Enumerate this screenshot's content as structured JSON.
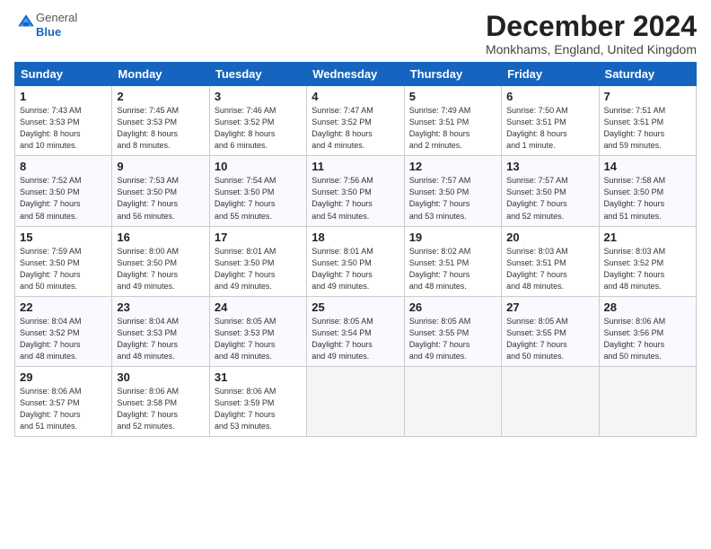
{
  "header": {
    "logo_general": "General",
    "logo_blue": "Blue",
    "month_title": "December 2024",
    "subtitle": "Monkhams, England, United Kingdom"
  },
  "days_of_week": [
    "Sunday",
    "Monday",
    "Tuesday",
    "Wednesday",
    "Thursday",
    "Friday",
    "Saturday"
  ],
  "weeks": [
    [
      {
        "day": "1",
        "sunrise": "7:43 AM",
        "sunset": "3:53 PM",
        "daylight": "8 hours and 10 minutes."
      },
      {
        "day": "2",
        "sunrise": "7:45 AM",
        "sunset": "3:53 PM",
        "daylight": "8 hours and 8 minutes."
      },
      {
        "day": "3",
        "sunrise": "7:46 AM",
        "sunset": "3:52 PM",
        "daylight": "8 hours and 6 minutes."
      },
      {
        "day": "4",
        "sunrise": "7:47 AM",
        "sunset": "3:52 PM",
        "daylight": "8 hours and 4 minutes."
      },
      {
        "day": "5",
        "sunrise": "7:49 AM",
        "sunset": "3:51 PM",
        "daylight": "8 hours and 2 minutes."
      },
      {
        "day": "6",
        "sunrise": "7:50 AM",
        "sunset": "3:51 PM",
        "daylight": "8 hours and 1 minute."
      },
      {
        "day": "7",
        "sunrise": "7:51 AM",
        "sunset": "3:51 PM",
        "daylight": "7 hours and 59 minutes."
      }
    ],
    [
      {
        "day": "8",
        "sunrise": "7:52 AM",
        "sunset": "3:50 PM",
        "daylight": "7 hours and 58 minutes."
      },
      {
        "day": "9",
        "sunrise": "7:53 AM",
        "sunset": "3:50 PM",
        "daylight": "7 hours and 56 minutes."
      },
      {
        "day": "10",
        "sunrise": "7:54 AM",
        "sunset": "3:50 PM",
        "daylight": "7 hours and 55 minutes."
      },
      {
        "day": "11",
        "sunrise": "7:56 AM",
        "sunset": "3:50 PM",
        "daylight": "7 hours and 54 minutes."
      },
      {
        "day": "12",
        "sunrise": "7:57 AM",
        "sunset": "3:50 PM",
        "daylight": "7 hours and 53 minutes."
      },
      {
        "day": "13",
        "sunrise": "7:57 AM",
        "sunset": "3:50 PM",
        "daylight": "7 hours and 52 minutes."
      },
      {
        "day": "14",
        "sunrise": "7:58 AM",
        "sunset": "3:50 PM",
        "daylight": "7 hours and 51 minutes."
      }
    ],
    [
      {
        "day": "15",
        "sunrise": "7:59 AM",
        "sunset": "3:50 PM",
        "daylight": "7 hours and 50 minutes."
      },
      {
        "day": "16",
        "sunrise": "8:00 AM",
        "sunset": "3:50 PM",
        "daylight": "7 hours and 49 minutes."
      },
      {
        "day": "17",
        "sunrise": "8:01 AM",
        "sunset": "3:50 PM",
        "daylight": "7 hours and 49 minutes."
      },
      {
        "day": "18",
        "sunrise": "8:01 AM",
        "sunset": "3:50 PM",
        "daylight": "7 hours and 49 minutes."
      },
      {
        "day": "19",
        "sunrise": "8:02 AM",
        "sunset": "3:51 PM",
        "daylight": "7 hours and 48 minutes."
      },
      {
        "day": "20",
        "sunrise": "8:03 AM",
        "sunset": "3:51 PM",
        "daylight": "7 hours and 48 minutes."
      },
      {
        "day": "21",
        "sunrise": "8:03 AM",
        "sunset": "3:52 PM",
        "daylight": "7 hours and 48 minutes."
      }
    ],
    [
      {
        "day": "22",
        "sunrise": "8:04 AM",
        "sunset": "3:52 PM",
        "daylight": "7 hours and 48 minutes."
      },
      {
        "day": "23",
        "sunrise": "8:04 AM",
        "sunset": "3:53 PM",
        "daylight": "7 hours and 48 minutes."
      },
      {
        "day": "24",
        "sunrise": "8:05 AM",
        "sunset": "3:53 PM",
        "daylight": "7 hours and 48 minutes."
      },
      {
        "day": "25",
        "sunrise": "8:05 AM",
        "sunset": "3:54 PM",
        "daylight": "7 hours and 49 minutes."
      },
      {
        "day": "26",
        "sunrise": "8:05 AM",
        "sunset": "3:55 PM",
        "daylight": "7 hours and 49 minutes."
      },
      {
        "day": "27",
        "sunrise": "8:05 AM",
        "sunset": "3:55 PM",
        "daylight": "7 hours and 50 minutes."
      },
      {
        "day": "28",
        "sunrise": "8:06 AM",
        "sunset": "3:56 PM",
        "daylight": "7 hours and 50 minutes."
      }
    ],
    [
      {
        "day": "29",
        "sunrise": "8:06 AM",
        "sunset": "3:57 PM",
        "daylight": "7 hours and 51 minutes."
      },
      {
        "day": "30",
        "sunrise": "8:06 AM",
        "sunset": "3:58 PM",
        "daylight": "7 hours and 52 minutes."
      },
      {
        "day": "31",
        "sunrise": "8:06 AM",
        "sunset": "3:59 PM",
        "daylight": "7 hours and 53 minutes."
      },
      null,
      null,
      null,
      null
    ]
  ]
}
